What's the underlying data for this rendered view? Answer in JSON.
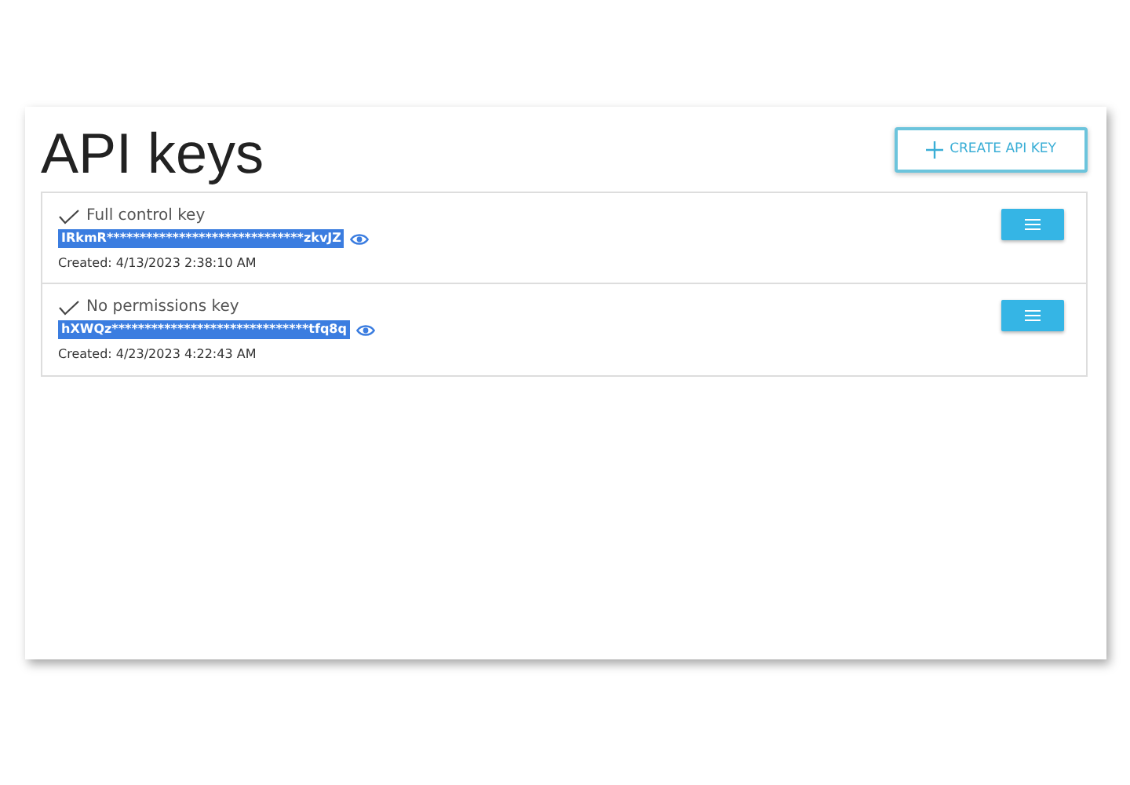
{
  "page": {
    "title": "API keys"
  },
  "create_button": {
    "label": "CREATE API KEY"
  },
  "keys": [
    {
      "name": "Full control key",
      "key": "IRkmR******************************zkvJZ",
      "created": "Created: 4/13/2023 2:38:10 AM"
    },
    {
      "name": "No permissions key",
      "key": "hXWQz******************************tfq8q",
      "created": "Created: 4/23/2023 4:22:43 AM"
    }
  ]
}
